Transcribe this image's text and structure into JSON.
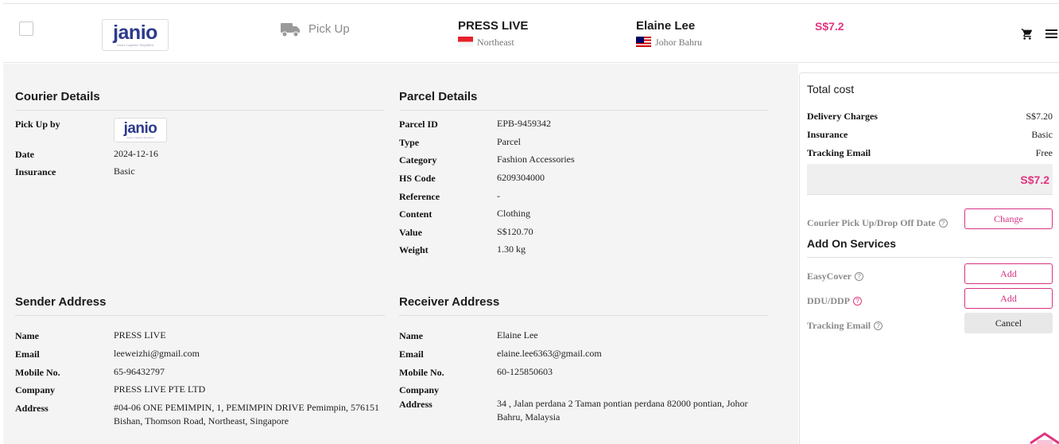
{
  "header": {
    "logo_text": "janio",
    "logo_tagline": "Asia's Logistics Simplified",
    "service": "Pick Up",
    "sender": {
      "name": "PRESS LIVE",
      "region": "Northeast"
    },
    "receiver": {
      "name": "Elaine Lee",
      "region": "Johor Bahru"
    },
    "price": "S$7.2"
  },
  "courier": {
    "title": "Courier Details",
    "rows": [
      {
        "label": "Pick Up by",
        "value": ""
      },
      {
        "label": "Date",
        "value": "2024-12-16"
      },
      {
        "label": "Insurance",
        "value": "Basic"
      }
    ]
  },
  "parcel": {
    "title": "Parcel Details",
    "rows": [
      {
        "label": "Parcel ID",
        "value": "EPB-9459342"
      },
      {
        "label": "Type",
        "value": "Parcel"
      },
      {
        "label": "Category",
        "value": "Fashion Accessories"
      },
      {
        "label": "HS Code",
        "value": "6209304000"
      },
      {
        "label": "Reference",
        "value": "-"
      },
      {
        "label": "Content",
        "value": "Clothing"
      },
      {
        "label": "Value",
        "value": "S$120.70"
      },
      {
        "label": "Weight",
        "value": "1.30 kg"
      }
    ]
  },
  "sender": {
    "title": "Sender Address",
    "rows": [
      {
        "label": "Name",
        "value": "PRESS LIVE"
      },
      {
        "label": "Email",
        "value": "leeweizhi@gmail.com"
      },
      {
        "label": "Mobile No.",
        "value": "65-96432797"
      },
      {
        "label": "Company",
        "value": "PRESS LIVE PTE LTD"
      },
      {
        "label": "Address",
        "value": "#04-06 ONE PEMIMPIN, 1, PEMIMPIN DRIVE Pemimpin, 576151 Bishan, Thomson Road, Northeast, Singapore"
      }
    ]
  },
  "receiver": {
    "title": "Receiver Address",
    "rows": [
      {
        "label": "Name",
        "value": "Elaine Lee"
      },
      {
        "label": "Email",
        "value": "elaine.lee6363@gmail.com"
      },
      {
        "label": "Mobile No.",
        "value": "60-125850603"
      },
      {
        "label": "Company",
        "value": ""
      },
      {
        "label": "Address",
        "value": "34 , Jalan perdana 2 Taman pontian perdana 82000 pontian, Johor Bahru, Malaysia"
      }
    ]
  },
  "cost": {
    "title": "Total cost",
    "rows": [
      {
        "label": "Delivery Charges",
        "value": "S$7.20"
      },
      {
        "label": "Insurance",
        "value": "Basic"
      },
      {
        "label": "Tracking Email",
        "value": "Free"
      }
    ],
    "total": "S$7.2",
    "pickup_date_label": "Courier Pick Up/Drop Off Date",
    "change_label": "Change",
    "addon_title": "Add On Services",
    "addons": [
      {
        "label": "EasyCover",
        "button": "Add"
      },
      {
        "label": "DDU/DDP",
        "button": "Add"
      },
      {
        "label": "Tracking Email",
        "button": "Cancel"
      }
    ]
  },
  "colors": {
    "accent": "#e0357f",
    "brand": "#2c3a8c"
  },
  "icons": [
    "checkbox",
    "truck-icon",
    "flag-sg-icon",
    "flag-my-icon",
    "cart-icon",
    "menu-icon",
    "help-icon"
  ]
}
